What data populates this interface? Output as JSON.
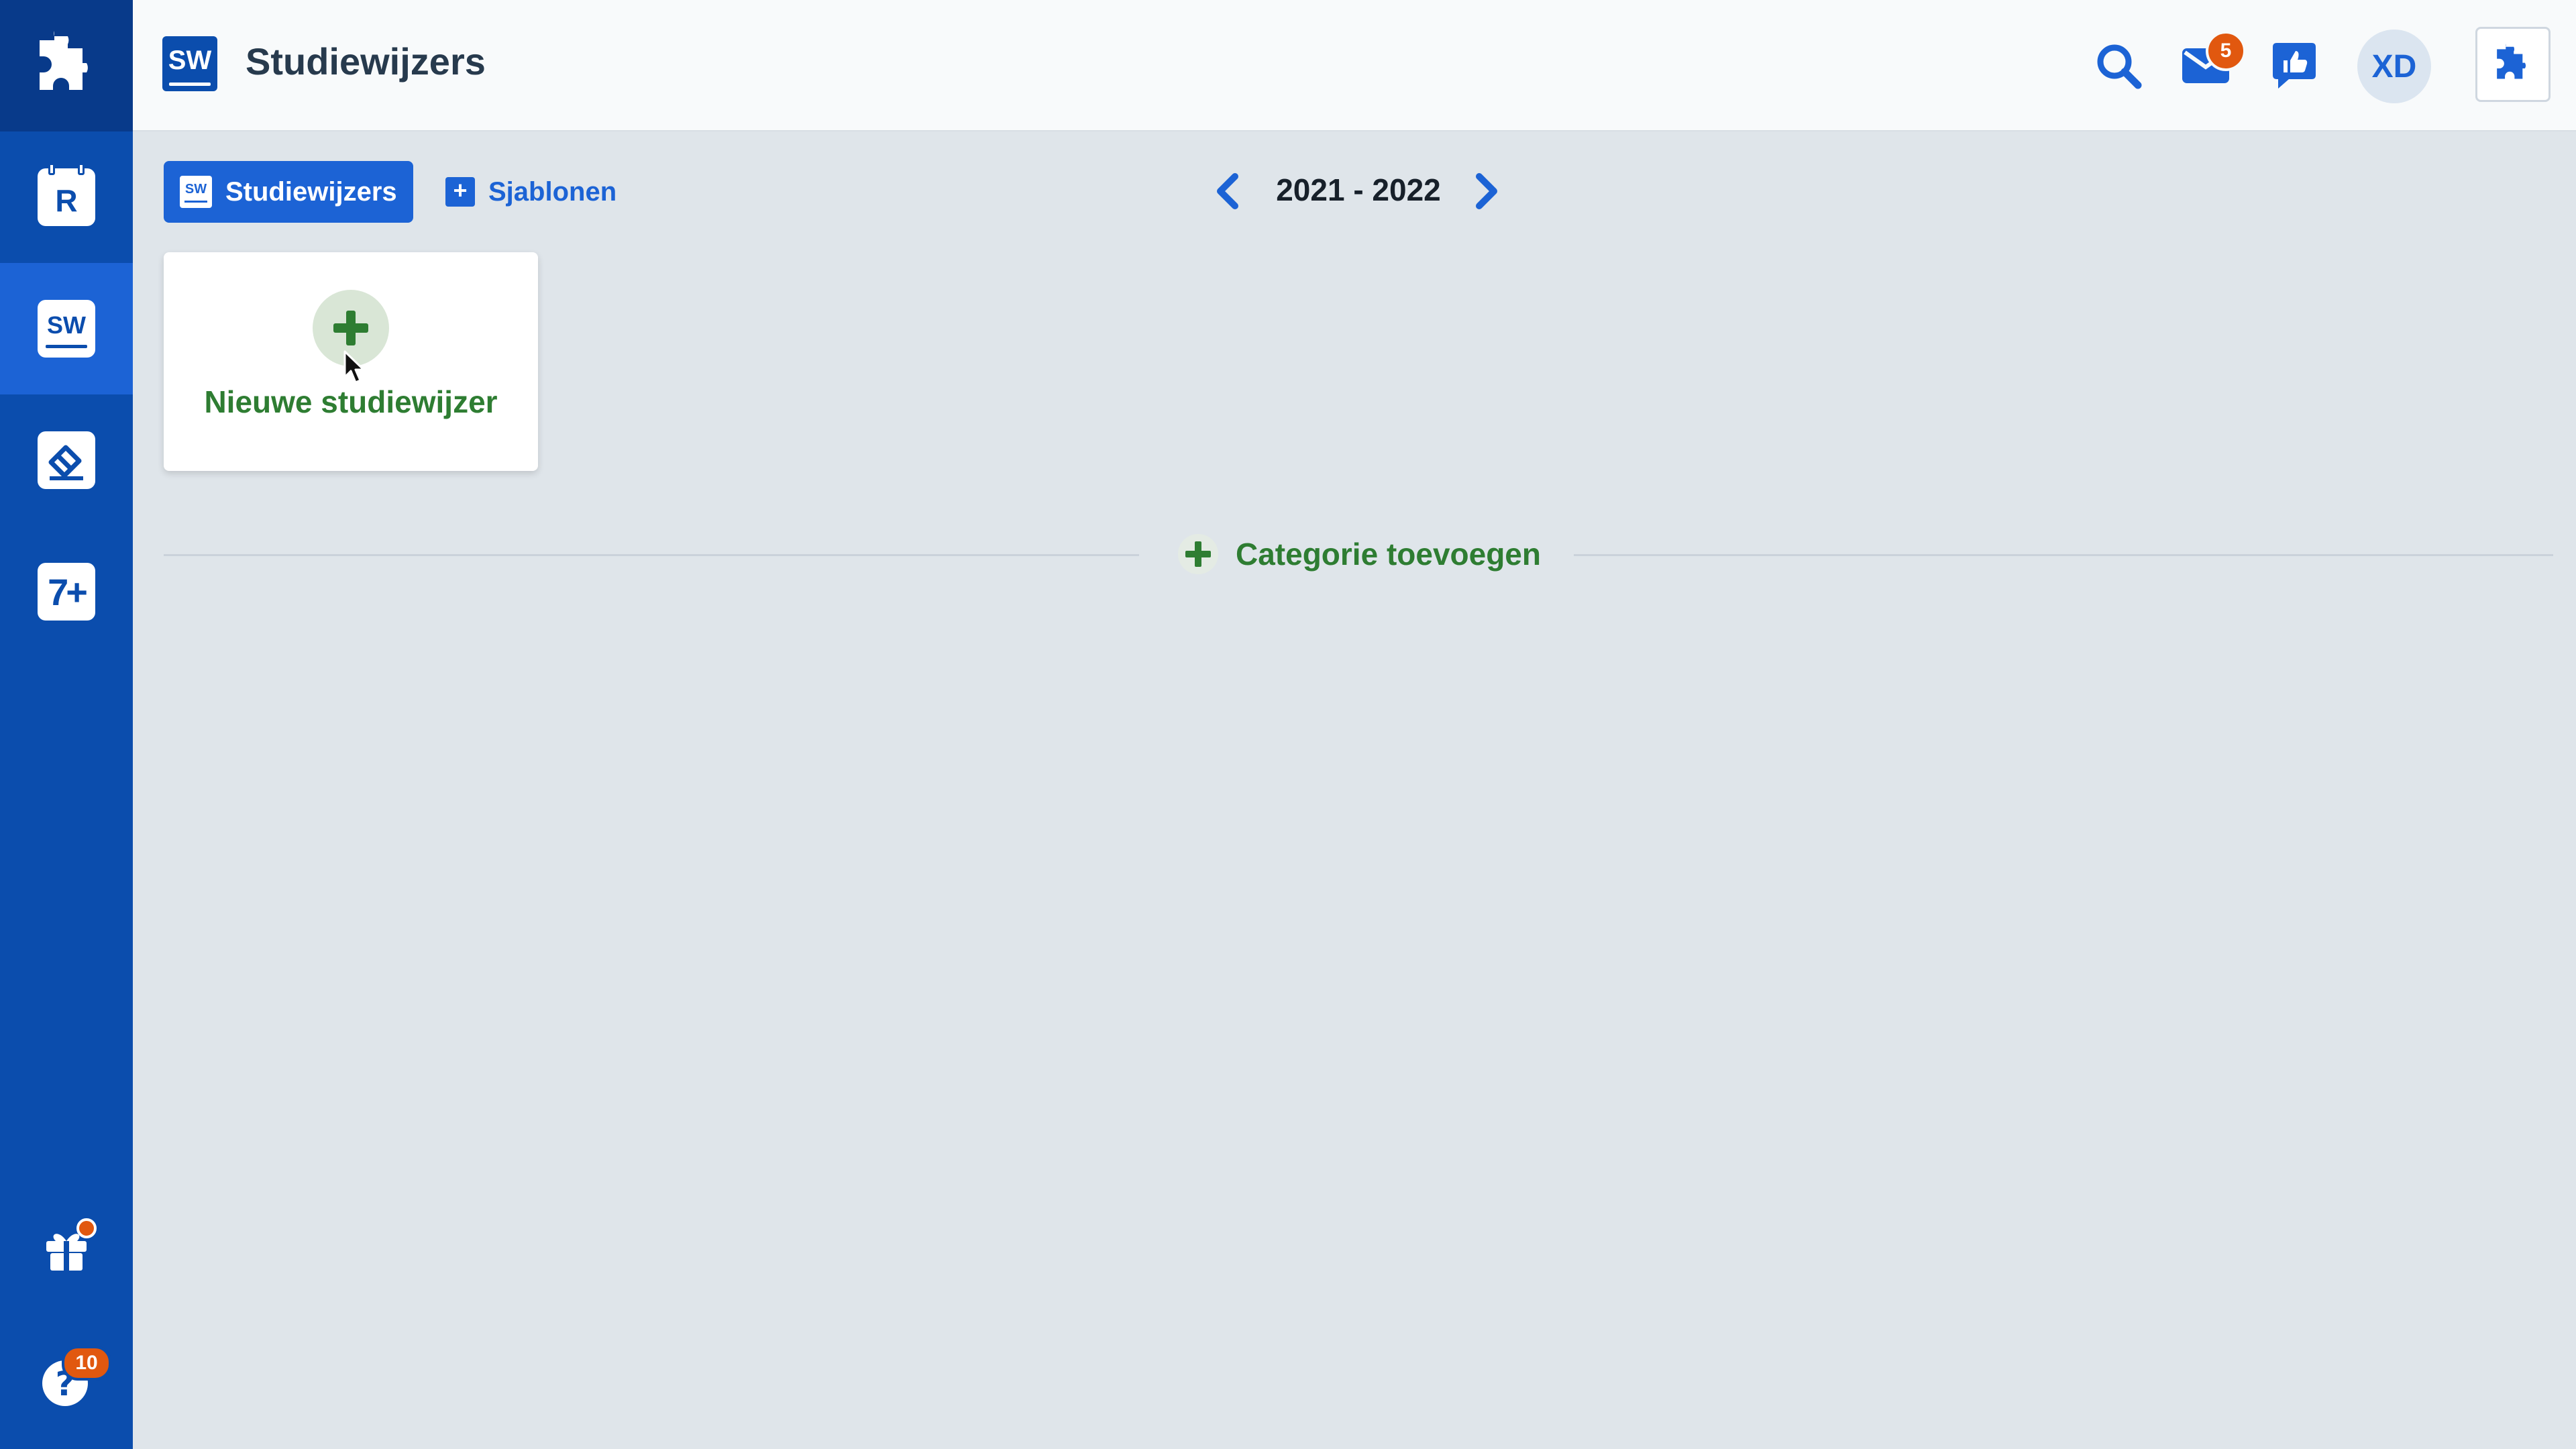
{
  "sidebar": {
    "logo_icon": "puzzle-logo-icon",
    "items": [
      {
        "name": "rooster",
        "letter": "R",
        "icon": "calendar-r-icon"
      },
      {
        "name": "studiewijzers",
        "letter": "SW",
        "icon": "studiewijzer-icon",
        "active": true
      },
      {
        "name": "inleveropdrachten",
        "icon": "eraser-icon"
      },
      {
        "name": "cijfers",
        "letter": "7+",
        "icon": "grades-icon"
      }
    ],
    "gift_icon": "gift-icon",
    "help_badge": "10",
    "help_icon": "help-icon"
  },
  "header": {
    "badge": "SW",
    "title": "Studiewijzers",
    "mail_badge": "5",
    "avatar_initials": "XD",
    "icons": [
      "search-icon",
      "mail-icon",
      "feedback-icon",
      "plugin-icon"
    ]
  },
  "tabs": {
    "active": {
      "label": "Studiewijzers",
      "icon_text": "SW"
    },
    "inactive": {
      "label": "Sjablonen"
    }
  },
  "year": {
    "label": "2021 - 2022"
  },
  "new_card": {
    "label": "Nieuwe studiewijzer"
  },
  "category": {
    "label": "Categorie toevoegen"
  },
  "colors": {
    "brand": "#0b4dad",
    "accent": "#1c63d5",
    "green": "#2e7d32",
    "badge": "#e1580f"
  }
}
